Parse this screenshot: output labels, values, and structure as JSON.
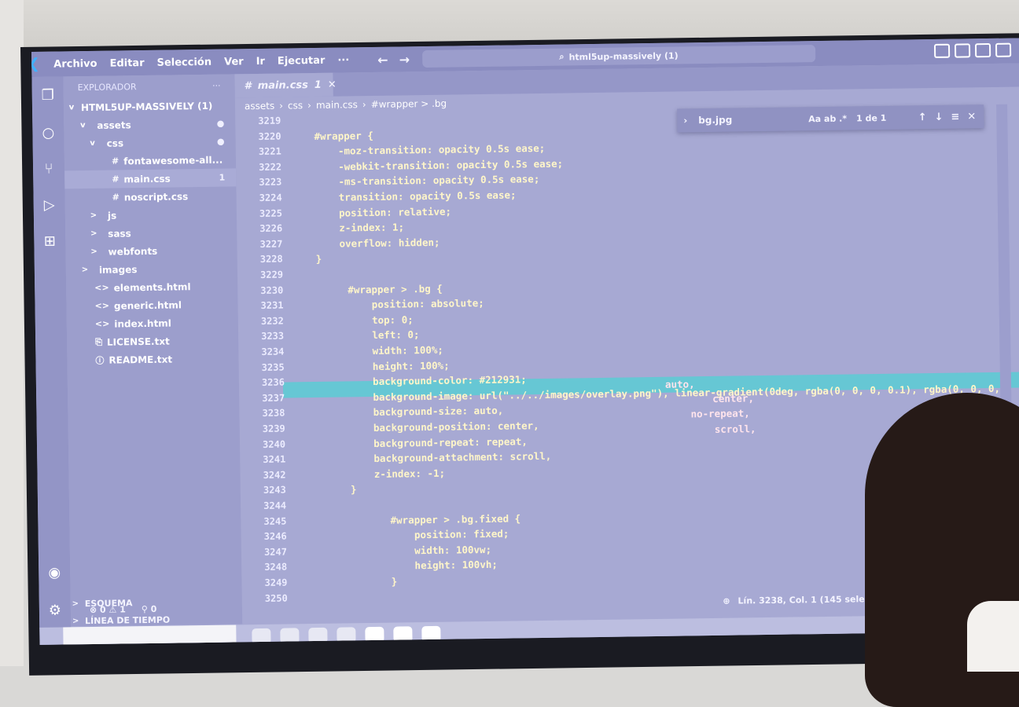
{
  "menu": [
    "Archivo",
    "Editar",
    "Selección",
    "Ver",
    "Ir",
    "Ejecutar",
    "···"
  ],
  "search_text": "html5up-massively (1)",
  "sidebar": {
    "title": "EXPLORADOR",
    "more": "···",
    "root": "HTML5UP-MASSIVELY (1)",
    "items": [
      {
        "label": "assets",
        "caret": "v",
        "icon": "",
        "badge": "●"
      },
      {
        "label": "css",
        "caret": "v",
        "icon": "",
        "badge": "●"
      },
      {
        "label": "fontawesome-all...",
        "caret": "",
        "icon": "#",
        "badge": ""
      },
      {
        "label": "main.css",
        "caret": "",
        "icon": "#",
        "badge": "1"
      },
      {
        "label": "noscript.css",
        "caret": "",
        "icon": "#",
        "badge": ""
      },
      {
        "label": "js",
        "caret": ">",
        "icon": "",
        "badge": ""
      },
      {
        "label": "sass",
        "caret": ">",
        "icon": "",
        "badge": ""
      },
      {
        "label": "webfonts",
        "caret": ">",
        "icon": "",
        "badge": ""
      },
      {
        "label": "images",
        "caret": ">",
        "icon": "",
        "badge": ""
      },
      {
        "label": "elements.html",
        "caret": "",
        "icon": "<>",
        "badge": ""
      },
      {
        "label": "generic.html",
        "caret": "",
        "icon": "<>",
        "badge": ""
      },
      {
        "label": "index.html",
        "caret": "",
        "icon": "<>",
        "badge": ""
      },
      {
        "label": "LICENSE.txt",
        "caret": "",
        "icon": "⎘",
        "badge": ""
      },
      {
        "label": "README.txt",
        "caret": "",
        "icon": "ⓘ",
        "badge": ""
      }
    ],
    "outline": "ESQUEMA",
    "timeline": "LÍNEA DE TIEMPO"
  },
  "tab": {
    "label": "main.css",
    "badge": "1"
  },
  "breadcrumb": [
    "assets",
    "css",
    "main.css",
    "#wrapper > .bg"
  ],
  "find": {
    "value": "bg.jpg",
    "options": "Aa ab .*",
    "count": "1 de 1"
  },
  "line_numbers": [
    "3219",
    "3220",
    "3221",
    "3222",
    "3223",
    "3224",
    "3225",
    "3226",
    "3227",
    "3228",
    "3229",
    "3230",
    "3231",
    "3232",
    "3233",
    "3234",
    "3235",
    "3236",
    "3237",
    "3238",
    "3239",
    "3240",
    "3241",
    "3242",
    "3243",
    "3244",
    "3245",
    "3246",
    "3247",
    "3248",
    "3249",
    "3250"
  ],
  "code_lines": [
    "",
    "#wrapper {",
    "    -moz-transition: opacity 0.5s ease;",
    "    -webkit-transition: opacity 0.5s ease;",
    "    -ms-transition: opacity 0.5s ease;",
    "    transition: opacity 0.5s ease;",
    "    position: relative;",
    "    z-index: 1;",
    "    overflow: hidden;",
    "}",
    "",
    "    #wrapper > .bg {",
    "        position: absolute;",
    "        top: 0;",
    "        left: 0;",
    "        width: 100%;",
    "        height: 100%;",
    "        background-color: #212931;",
    "        background-image: url(\"../../images/overlay.png\"), linear-gradient(0deg, rgba(0, 0, 0, 0.1), rgba(0, 0, 0,",
    "        background-size: auto,",
    "        background-position: center,",
    "        background-repeat: repeat,",
    "        background-attachment: scroll,",
    "        z-index: -1;",
    "    }",
    "",
    "        #wrapper > .bg.fixed {",
    "            position: fixed;",
    "            width: 100vw;",
    "            height: 100vh;",
    "        }",
    ""
  ],
  "extra_code": {
    "line3237": "auto,",
    "line3238": "center,",
    "line3239": "no-repeat,",
    "line3240": "scroll,"
  },
  "status": {
    "errors": "⊗ 0 ⚠ 1",
    "ports": "⚲ 0",
    "position": "Lín. 3238, Col. 1 (145 seleccionado)"
  },
  "colors": {
    "editor_bg": "#a7a9d3",
    "selection": "#66c7d4"
  }
}
